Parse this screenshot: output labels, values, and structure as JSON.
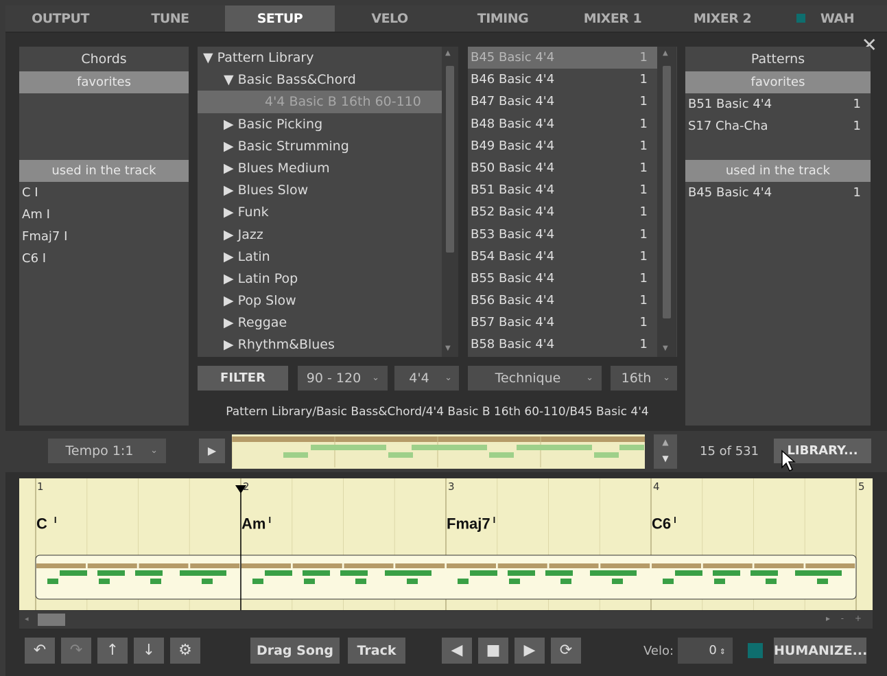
{
  "tabs": [
    "OUTPUT",
    "TUNE",
    "SETUP",
    "VELO",
    "TIMING",
    "MIXER 1",
    "MIXER 2",
    "WAH"
  ],
  "active_tab": "SETUP",
  "close_icon": "close-icon",
  "chords_panel": {
    "title": "Chords",
    "favorites_label": "favorites",
    "used_label": "used in the track",
    "used_items": [
      "C I",
      "Am I",
      "Fmaj7 I",
      "C6 I"
    ]
  },
  "library": {
    "items": [
      {
        "label": "▼ Pattern Library",
        "indent": 0
      },
      {
        "label": "▼ Basic Bass&Chord",
        "indent": 1
      },
      {
        "label": "4'4 Basic B 16th 60-110",
        "indent": 2
      },
      {
        "label": "▶ Basic Picking",
        "indent": 1
      },
      {
        "label": "▶ Basic Strumming",
        "indent": 1
      },
      {
        "label": "▶ Blues Medium",
        "indent": 1
      },
      {
        "label": "▶ Blues Slow",
        "indent": 1
      },
      {
        "label": "▶ Funk",
        "indent": 1
      },
      {
        "label": "▶ Jazz",
        "indent": 1
      },
      {
        "label": "▶ Latin",
        "indent": 1
      },
      {
        "label": "▶ Latin Pop",
        "indent": 1
      },
      {
        "label": "▶ Pop Slow",
        "indent": 1
      },
      {
        "label": "▶ Reggae",
        "indent": 1
      },
      {
        "label": "▶ Rhythm&Blues",
        "indent": 1
      }
    ]
  },
  "pattern_list": {
    "items": [
      {
        "name": "B45 Basic 4'4",
        "count": "1"
      },
      {
        "name": "B46 Basic 4'4",
        "count": "1"
      },
      {
        "name": "B47 Basic 4'4",
        "count": "1"
      },
      {
        "name": "B48 Basic 4'4",
        "count": "1"
      },
      {
        "name": "B49 Basic 4'4",
        "count": "1"
      },
      {
        "name": "B50 Basic 4'4",
        "count": "1"
      },
      {
        "name": "B51 Basic 4'4",
        "count": "1"
      },
      {
        "name": "B52 Basic 4'4",
        "count": "1"
      },
      {
        "name": "B53 Basic 4'4",
        "count": "1"
      },
      {
        "name": "B54 Basic 4'4",
        "count": "1"
      },
      {
        "name": "B55 Basic 4'4",
        "count": "1"
      },
      {
        "name": "B56 Basic 4'4",
        "count": "1"
      },
      {
        "name": "B57 Basic 4'4",
        "count": "1"
      },
      {
        "name": "B58 Basic 4'4",
        "count": "1"
      }
    ]
  },
  "patterns_panel": {
    "title": "Patterns",
    "favorites_label": "favorites",
    "favorites": [
      {
        "name": "B51 Basic 4'4",
        "count": "1"
      },
      {
        "name": "S17 Cha-Cha",
        "count": "1"
      }
    ],
    "used_label": "used in the track",
    "used": [
      {
        "name": "B45 Basic 4'4",
        "count": "1"
      }
    ]
  },
  "filter": {
    "button": "FILTER",
    "tempo_range": "90 - 120",
    "meter": "4'4",
    "technique": "Technique",
    "resolution": "16th"
  },
  "path": "Pattern Library/Basic Bass&Chord/4'4 Basic B 16th 60-110/B45 Basic 4'4",
  "preview": {
    "tempo": "Tempo 1:1",
    "counter": "15 of 531",
    "library_button": "LIBRARY..."
  },
  "track": {
    "bars": [
      "1",
      "2",
      "3",
      "4",
      "5"
    ],
    "chords": [
      {
        "root": "C",
        "mark": "I"
      },
      {
        "root": "Am",
        "mark": "I"
      },
      {
        "root": "Fmaj7",
        "mark": "I"
      },
      {
        "root": "C6",
        "mark": "I"
      }
    ]
  },
  "bottom": {
    "drag_song": "Drag Song",
    "track": "Track",
    "velo_label": "Velo:",
    "velo_value": "0",
    "humanize": "HUMANIZE...",
    "scroll_marks": "▸ - +"
  },
  "colors": {
    "accent_teal": "#0e6e6e",
    "track_bg": "#f2efc4",
    "note_green": "#3aa046",
    "bar_tan": "#b59b68"
  }
}
